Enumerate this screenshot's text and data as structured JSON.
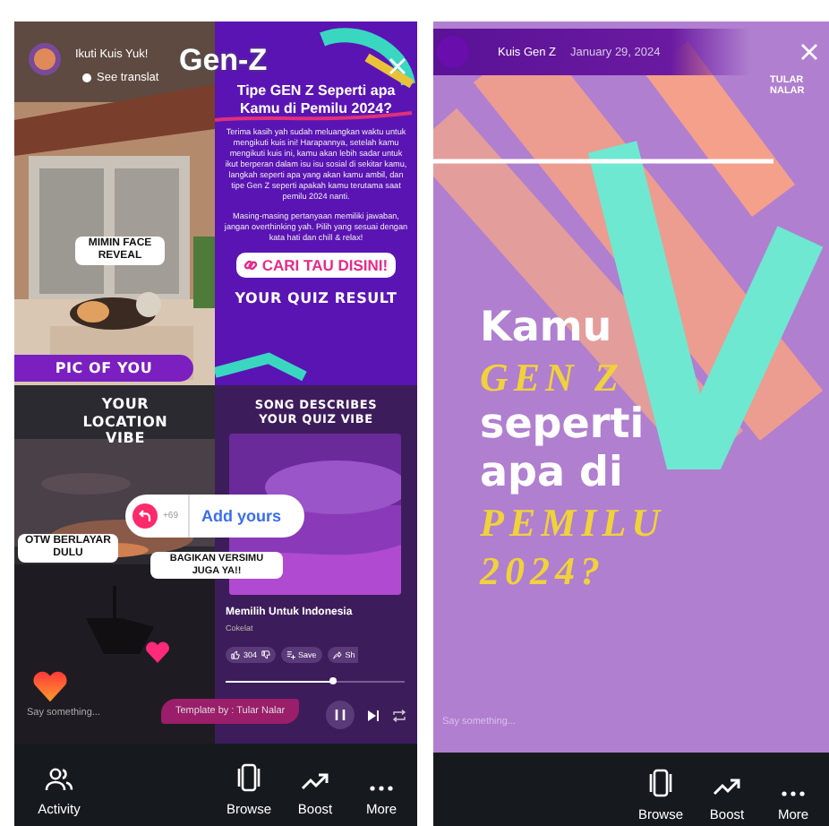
{
  "left_story": {
    "account": "Ikuti Kuis Yuk!",
    "see_translation": "See translat",
    "logo": "Gen-Z",
    "photo_panel": {
      "sticker": "MIMIN FACE REVEAL",
      "caption": "PIC OF YOU"
    },
    "info_panel": {
      "title": "Tipe GEN Z Seperti apa Kamu di Pemilu 2024?",
      "paragraphs": [
        "Terima kasih yah sudah meluangkan waktu untuk mengikuti kuis ini! Harapannya, setelah kamu mengikuti kuis ini, kamu akan lebih sadar untuk ikut berperan dalam isu isu sosial di sekitar kamu, langkah seperti apa yang akan kamu ambil, dan tipe Gen Z seperti apakah kamu terutama saat pemilu 2024 nanti.",
        "Masing-masing pertanyaan memiliki jawaban, jangan overthinking yah. Pilih yang sesuai dengan kata hati dan chill & relax!"
      ],
      "link": "CARI TAU DISINI!",
      "caption": "YOUR QUIZ RESULT"
    },
    "location_panel": {
      "caption": "YOUR LOCATION VIBE",
      "sticker": "OTW BERLAYAR DULU"
    },
    "song_panel": {
      "caption": "SONG DESCRIBES YOUR QUIZ VIBE",
      "title": "Memilih Untuk Indonesia",
      "artist": "Cokelat",
      "likes": "304",
      "save": "Save",
      "share": "Sh",
      "progress": {
        "level": 0.6
      }
    },
    "add_yours": {
      "count": "+69",
      "label": "Add yours",
      "note": "BAGIKAN VERSIMU JUGA YA!!"
    },
    "reply_placeholder": "Say something...",
    "template_credit": "Template by : Tular Nalar"
  },
  "left_bar": [
    {
      "label": "Activity",
      "kind": "activity"
    },
    {
      "label": "Browse",
      "kind": "browse"
    },
    {
      "label": "Boost",
      "kind": "boost"
    },
    {
      "label": "More",
      "kind": "more"
    }
  ],
  "right_story": {
    "account": "Kuis Gen Z",
    "date": "January 29, 2024",
    "brand": "TULAR NALAR",
    "headline": [
      {
        "text": "Kamu",
        "kind": "plain"
      },
      {
        "text": "GEN Z",
        "kind": "script"
      },
      {
        "text": "seperti",
        "kind": "plain"
      },
      {
        "text": "apa di",
        "kind": "plain"
      },
      {
        "text": "PEMILU",
        "kind": "script"
      },
      {
        "text": "2024?",
        "kind": "script"
      }
    ],
    "reply_placeholder": "Say something..."
  },
  "right_bar": [
    {
      "label": "Browse",
      "kind": "browse"
    },
    {
      "label": "Boost",
      "kind": "boost"
    },
    {
      "label": "More",
      "kind": "more"
    }
  ]
}
